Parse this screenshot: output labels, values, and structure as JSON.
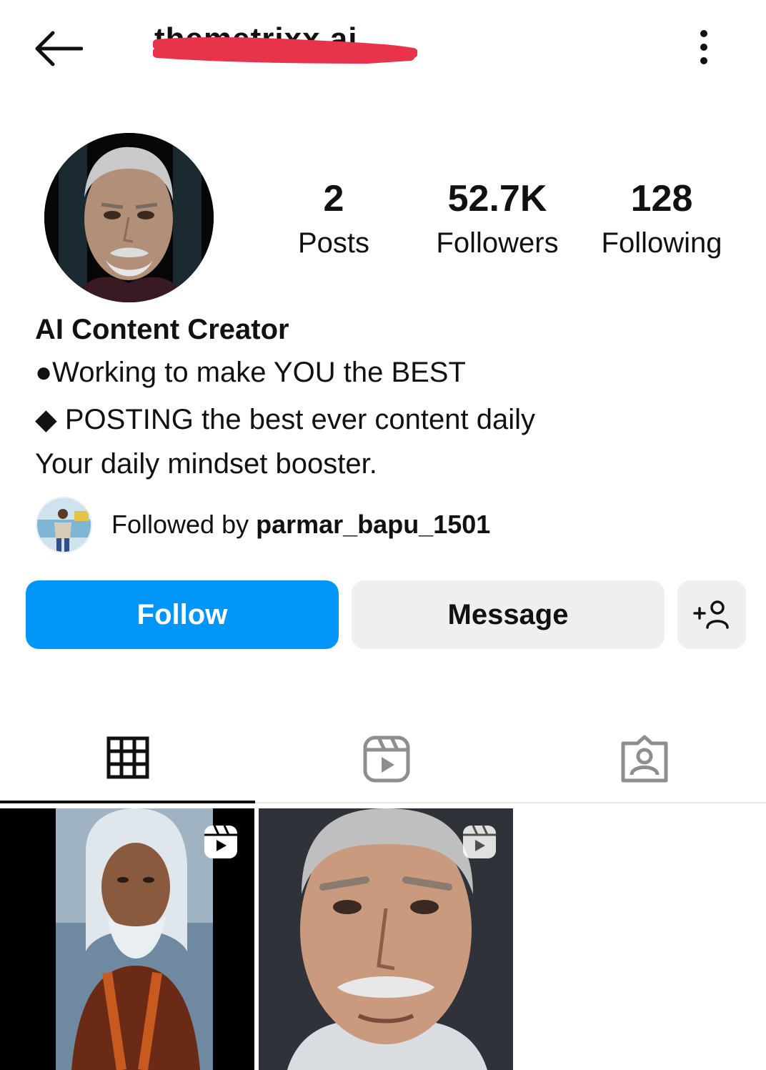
{
  "header": {
    "username": "themetrixx.ai"
  },
  "stats": {
    "posts_count": "2",
    "posts_label": "Posts",
    "followers_count": "52.7K",
    "followers_label": "Followers",
    "following_count": "128",
    "following_label": "Following"
  },
  "bio": {
    "name": "AI Content Creator",
    "line1": "●Working to make YOU the BEST",
    "line2": "◆ POSTING the best ever content daily",
    "line3": "Your daily mindset booster."
  },
  "followed_by": {
    "prefix": "Followed by ",
    "username": "parmar_bapu_1501"
  },
  "buttons": {
    "follow_label": "Follow",
    "message_label": "Message"
  },
  "tabs": [
    {
      "name": "grid",
      "icon": "grid-icon",
      "active": true
    },
    {
      "name": "reels",
      "icon": "reels-icon",
      "active": false
    },
    {
      "name": "tagged",
      "icon": "tagged-icon",
      "active": false
    }
  ],
  "posts": [
    {
      "kind": "reel",
      "icon": "reel-badge-icon"
    },
    {
      "kind": "reel",
      "icon": "reel-badge-icon"
    }
  ],
  "colors": {
    "follow_button": "#0095f6",
    "secondary_button": "#efefef",
    "redaction": "#e8344a"
  }
}
